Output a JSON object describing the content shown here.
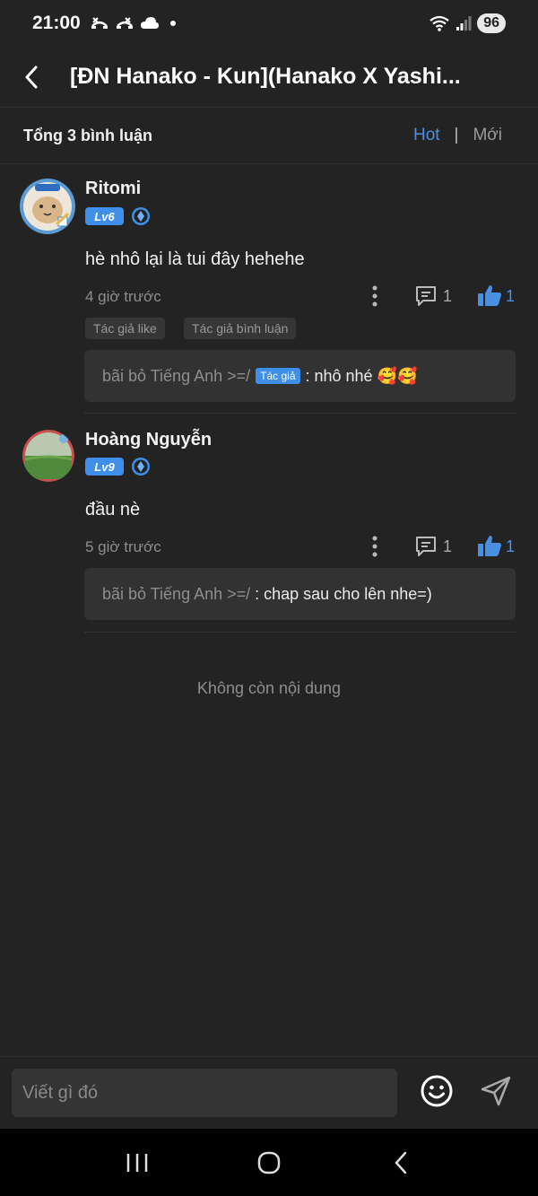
{
  "status": {
    "time": "21:00",
    "battery": "96"
  },
  "header": {
    "title": "[ĐN Hanako - Kun](Hanako X Yashi..."
  },
  "subheader": {
    "total": "Tổng 3 bình luận",
    "sort_hot": "Hot",
    "sort_sep": "|",
    "sort_new": "Mới"
  },
  "comments": [
    {
      "username": "Ritomi",
      "level": "Lv6",
      "content": "hè nhô lại là tui đây hehehe",
      "time": "4 giờ trước",
      "reply_count": "1",
      "like_count": "1",
      "tags": [
        "Tác giả like",
        "Tác giả bình luận"
      ],
      "reply": {
        "name": "bãi bỏ Tiếng Anh >=/",
        "author_tag": "Tác giả",
        "text": ": nhô nhé 🥰🥰"
      }
    },
    {
      "username": "Hoàng Nguyễn",
      "level": "Lv9",
      "content": "đầu nè",
      "time": "5 giờ trước",
      "reply_count": "1",
      "like_count": "1",
      "reply": {
        "name": "bãi bỏ Tiếng Anh >=/",
        "text": ": chap sau cho lên nhe=)"
      }
    }
  ],
  "end_text": "Không còn nội dung",
  "input": {
    "placeholder": "Viết gì đó"
  },
  "colors": {
    "accent": "#4a90e2",
    "background": "#232323",
    "level_badge": "#3d8fea"
  }
}
